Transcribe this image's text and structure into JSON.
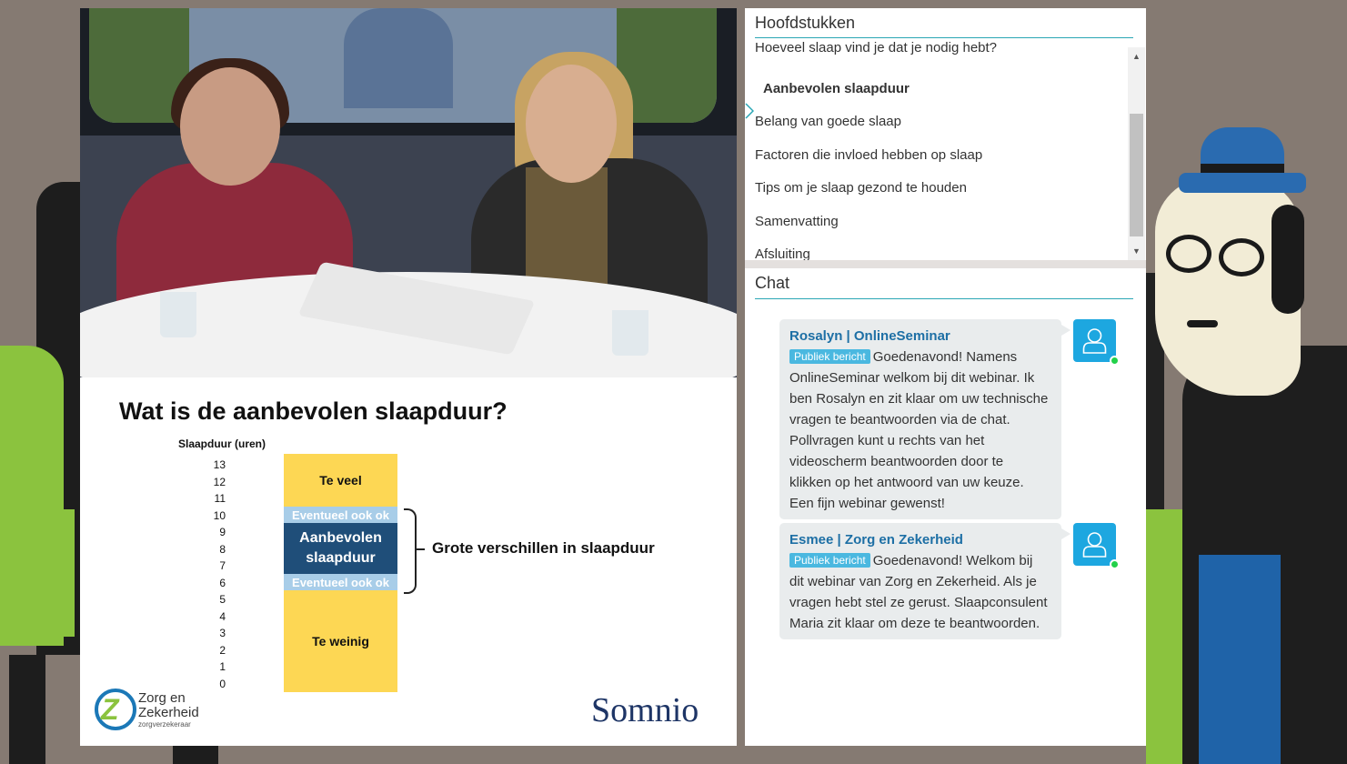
{
  "chapters": {
    "title": "Hoofdstukken",
    "items": [
      {
        "label": "Hoeveel slaap vind je dat je nodig hebt?",
        "active": false
      },
      {
        "label": "Aanbevolen slaapduur",
        "active": true
      },
      {
        "label": "Belang van goede slaap",
        "active": false
      },
      {
        "label": "Factoren die invloed hebben op slaap",
        "active": false
      },
      {
        "label": "Tips om je slaap gezond te houden",
        "active": false
      },
      {
        "label": "Samenvatting",
        "active": false
      },
      {
        "label": "Afsluiting",
        "active": false
      }
    ]
  },
  "chat": {
    "title": "Chat",
    "messages": [
      {
        "author": "Rosalyn | OnlineSeminar",
        "badge": "Publiek bericht",
        "lines": [
          "Goedenavond! Namens",
          "OnlineSeminar welkom bij dit webinar. Ik",
          "ben Rosalyn en zit klaar om uw technische",
          "vragen te beantwoorden via de chat.",
          "Pollvragen kunt u rechts van het",
          "videoscherm beantwoorden door te",
          "klikken op het antwoord van uw keuze.",
          "Een fijn webinar gewenst!"
        ],
        "status": "online"
      },
      {
        "author": "Esmee | Zorg en Zekerheid",
        "badge": "Publiek bericht",
        "lines": [
          "Goedenavond! Welkom bij",
          "dit webinar van Zorg en Zekerheid. Als je",
          "vragen hebt stel ze gerust. Slaapconsulent",
          "Maria zit klaar om deze te beantwoorden."
        ],
        "status": "online"
      }
    ]
  },
  "slide": {
    "title": "Wat is de aanbevolen slaapduur?",
    "ylabel": "Slaapduur (uren)",
    "yticks": [
      "13",
      "12",
      "11",
      "10",
      "9",
      "8",
      "7",
      "6",
      "5",
      "4",
      "3",
      "2",
      "1",
      "0"
    ],
    "bands": {
      "too_much": "Te veel",
      "optional_top": "Eventueel ook ok",
      "recommended_1": "Aanbevolen",
      "recommended_2": "slaapduur",
      "optional_bottom": "Eventueel ook ok",
      "too_little": "Te weinig"
    },
    "brace_label": "Grote verschillen in slaapduur",
    "logo_zz": {
      "mark": "Z",
      "line1": "Zorg en",
      "line2": "Zekerheid",
      "line3": "zorgverzekeraar"
    },
    "logo_somnio": "Somnio",
    "colors": {
      "yellow": "#fdd754",
      "light_blue": "#a8cde8",
      "dark_blue": "#1f4e79"
    }
  },
  "colors": {
    "accent": "#2ba7b5",
    "author": "#1d6fa5",
    "badge": "#4ab8e0",
    "avatar": "#1da7e0",
    "online": "#22d14a"
  },
  "icons": {
    "avatar": "user-icon",
    "scroll_up": "scroll-up-arrow-icon",
    "scroll_down": "scroll-down-arrow-icon",
    "active_chapter": "chevron-right-icon"
  }
}
